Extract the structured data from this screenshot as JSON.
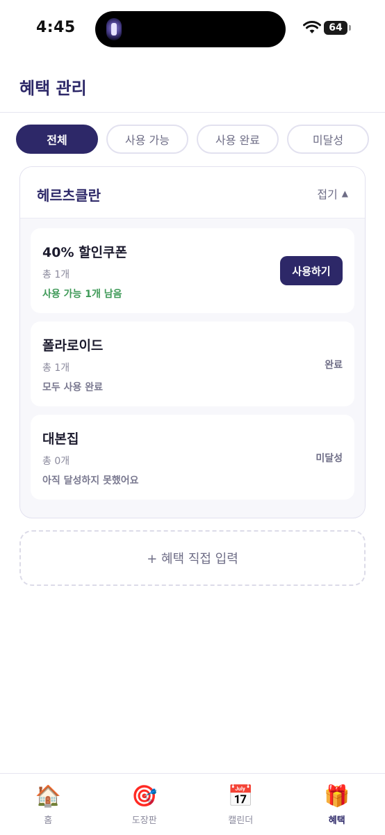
{
  "status_bar": {
    "time": "4:45",
    "battery": "64",
    "icons": [
      "flashlight-icon",
      "wifi-icon",
      "battery-icon"
    ]
  },
  "header": {
    "title": "혜택 관리"
  },
  "filters": [
    {
      "label": "전체",
      "active": true
    },
    {
      "label": "사용 가능",
      "active": false
    },
    {
      "label": "사용 완료",
      "active": false
    },
    {
      "label": "미달성",
      "active": false
    }
  ],
  "group": {
    "title": "헤르츠클란",
    "collapse_label": "접기",
    "collapse_icon": "caret-up-icon",
    "items": [
      {
        "name": "40% 할인쿠폰",
        "count": "총 1개",
        "status": "사용 가능 1개 남음",
        "action_label": "사용하기"
      },
      {
        "name": "폴라로이드",
        "count": "총 1개",
        "status": "모두 사용 완료",
        "right_label": "완료"
      },
      {
        "name": "대본집",
        "count": "총 0개",
        "status": "아직 달성하지 못했어요",
        "right_label": "미달성"
      }
    ]
  },
  "add_benefit": {
    "label": "+ 혜택 직접 입력"
  },
  "bottom_nav": [
    {
      "label": "홈",
      "icon": "house-icon",
      "glyph": "🏠",
      "active": false
    },
    {
      "label": "도장판",
      "icon": "dart-target-icon",
      "glyph": "🎯",
      "active": false
    },
    {
      "label": "캘린더",
      "icon": "calendar-icon",
      "glyph": "📅",
      "active": false
    },
    {
      "label": "혜택",
      "icon": "gift-icon",
      "glyph": "🎁",
      "active": true
    }
  ],
  "colors": {
    "primary": "#2d2868",
    "available_green": "#3f9a58",
    "muted_text": "#6e6d86",
    "border": "#e2e1ef"
  }
}
